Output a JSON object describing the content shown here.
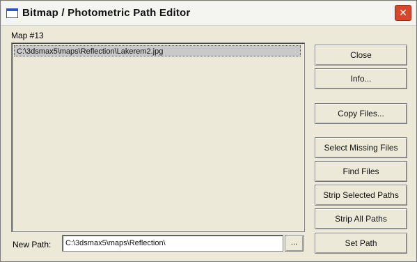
{
  "window": {
    "title": "Bitmap / Photometric Path Editor",
    "close_symbol": "✕"
  },
  "map_label": "Map #13",
  "file_list": {
    "items": [
      "C:\\3dsmax5\\maps\\Reflection\\Lakerem2.jpg"
    ]
  },
  "buttons": {
    "close": "Close",
    "info": "Info...",
    "copy_files": "Copy Files...",
    "select_missing": "Select Missing Files",
    "find_files": "Find Files",
    "strip_selected": "Strip Selected Paths",
    "strip_all": "Strip All Paths",
    "set_path": "Set Path"
  },
  "new_path": {
    "label": "New Path:",
    "value": "C:\\3dsmax5\\maps\\Reflection\\",
    "browse_label": "..."
  }
}
